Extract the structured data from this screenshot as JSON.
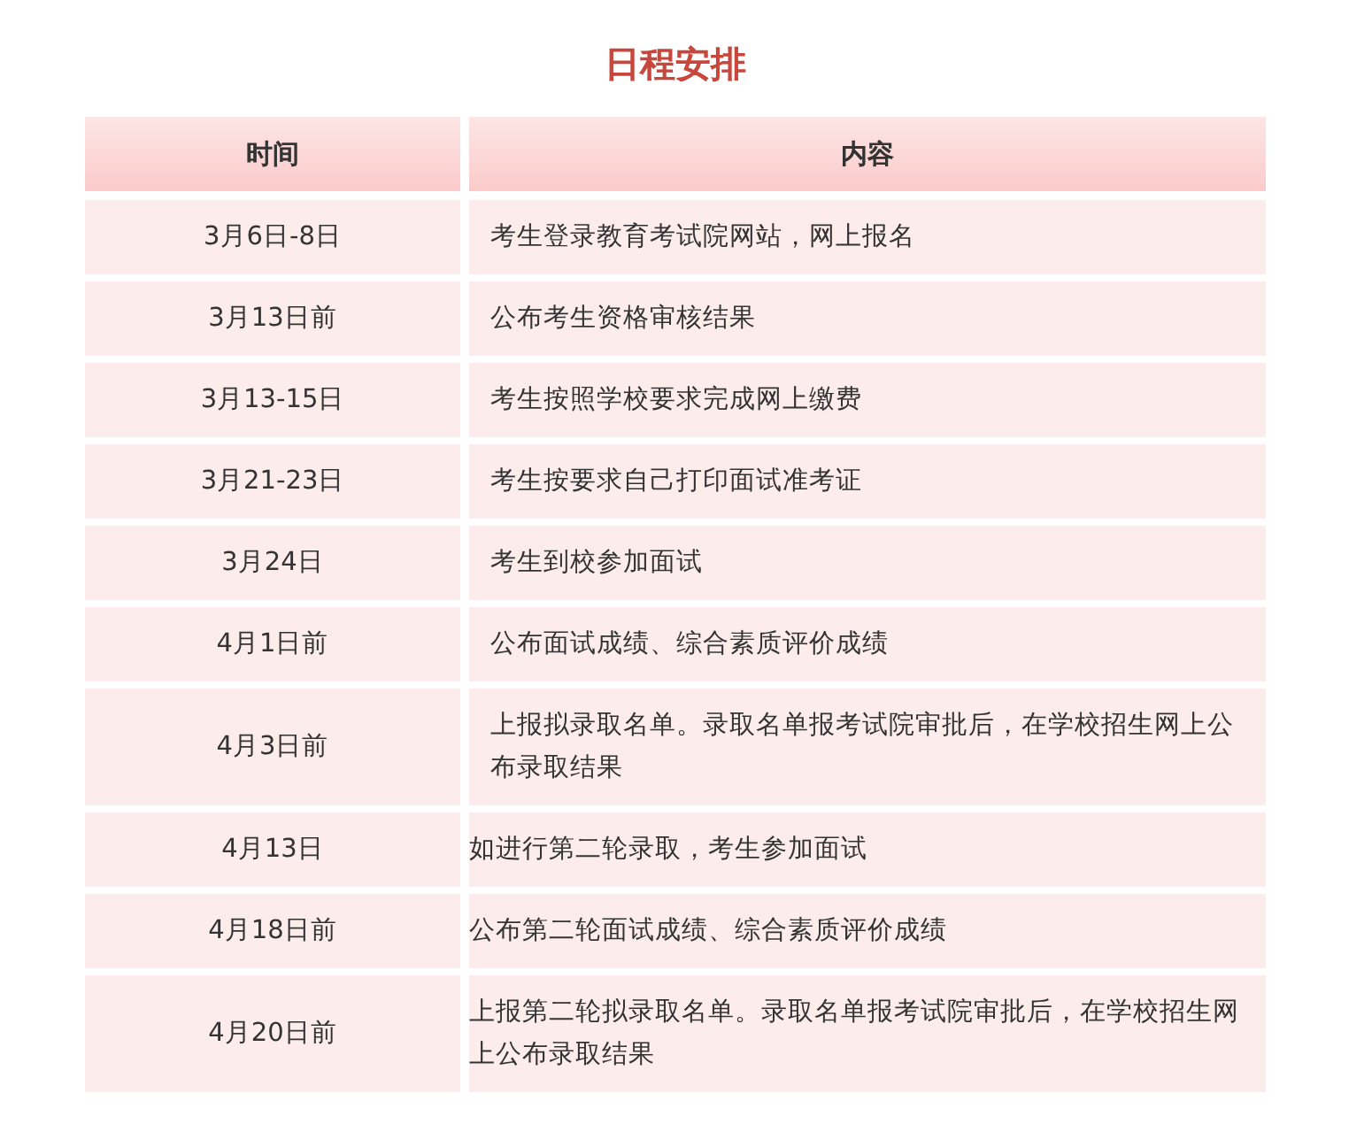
{
  "title": "日程安排",
  "table": {
    "columns": [
      "时间",
      "内容"
    ],
    "rows": [
      {
        "time": "3月6日-8日",
        "content": "考生登录教育考试院网站，网上报名",
        "indented": true
      },
      {
        "time": "3月13日前",
        "content": "公布考生资格审核结果",
        "indented": true
      },
      {
        "time": "3月13-15日",
        "content": "考生按照学校要求完成网上缴费",
        "indented": true
      },
      {
        "time": "3月21-23日",
        "content": "考生按要求自己打印面试准考证",
        "indented": true
      },
      {
        "time": "3月24日",
        "content": "考生到校参加面试",
        "indented": true
      },
      {
        "time": "4月1日前",
        "content": "公布面试成绩、综合素质评价成绩",
        "indented": true
      },
      {
        "time": "4月3日前",
        "content": "上报拟录取名单。录取名单报考试院审批后，在学校招生网上公布录取结果",
        "indented": true
      },
      {
        "time": "4月13日",
        "content": "如进行第二轮录取，考生参加面试",
        "indented": false
      },
      {
        "time": "4月18日前",
        "content": "公布第二轮面试成绩、综合素质评价成绩",
        "indented": false
      },
      {
        "time": "4月20日前",
        "content": "上报第二轮拟录取名单。录取名单报考试院审批后，在学校招生网上公布录取结果",
        "indented": false
      }
    ]
  }
}
